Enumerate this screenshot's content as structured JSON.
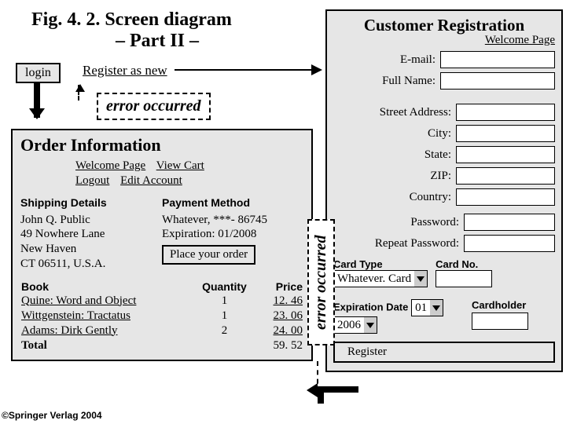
{
  "figure": {
    "caption_l1": "Fig. 4. 2. Screen diagram",
    "caption_l2": "– Part II –"
  },
  "login": {
    "button": "login",
    "register_link": "Register as new"
  },
  "errors": {
    "e1": "error occurred",
    "e2": "error occurred"
  },
  "order": {
    "title": "Order Information",
    "links": {
      "welcome": "Welcome Page",
      "view_cart": "View Cart",
      "logout": "Logout",
      "edit_account": "Edit Account"
    },
    "shipping_header": "Shipping Details",
    "payment_header": "Payment Method",
    "address": [
      "John Q. Public",
      "49 Nowhere Lane",
      "New Haven",
      "CT 06511, U.S.A."
    ],
    "payment": [
      "Whatever, ***- 86745",
      "Expiration: 01/2008"
    ],
    "place_order": "Place your order",
    "columns": {
      "book": "Book",
      "qty": "Quantity",
      "price": "Price"
    },
    "rows": [
      {
        "book": "Quine: Word and Object",
        "qty": "1",
        "price": "12. 46"
      },
      {
        "book": "Wittgenstein: Tractatus",
        "qty": "1",
        "price": "23. 06"
      },
      {
        "book": "Adams: Dirk Gently",
        "qty": "2",
        "price": "24. 00"
      }
    ],
    "total_label": "Total",
    "total": "59. 52"
  },
  "registration": {
    "title": "Customer Registration",
    "welcome": "Welcome Page",
    "fields": {
      "email": "E-mail:",
      "full_name": "Full Name:",
      "street": "Street Address:",
      "city": "City:",
      "state": "State:",
      "zip": "ZIP:",
      "country": "Country:",
      "password": "Password:",
      "repeat_password": "Repeat Password:"
    },
    "card_type_label": "Card Type",
    "card_type_value": "Whatever. Card",
    "card_no_label": "Card No.",
    "exp_label": "Expiration Date",
    "exp_month": "01",
    "exp_year": "2006",
    "cardholder_label": "Cardholder",
    "register_button": "Register"
  },
  "credit": "©Springer Verlag 2004"
}
